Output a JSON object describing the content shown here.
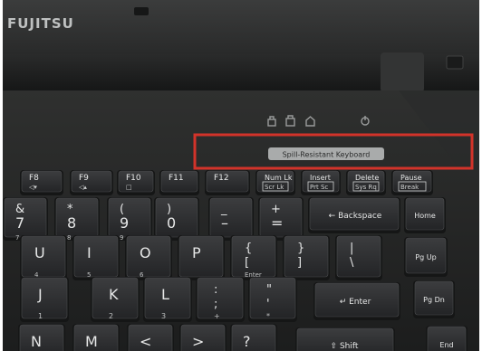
{
  "brand": {
    "logo_text": "FUJITSU"
  },
  "palmrest_label": "Spill-Resistant Keyboard",
  "highlight": {
    "stroke_color": "#d2332a"
  },
  "keys": {
    "row_fn": [
      {
        "id": "f8",
        "main": "F8",
        "sub": "◁▾"
      },
      {
        "id": "f9",
        "main": "F9",
        "sub": "◁▴"
      },
      {
        "id": "f10",
        "main": "F10",
        "sub": "□"
      },
      {
        "id": "f11",
        "main": "F11",
        "sub": ""
      },
      {
        "id": "f12",
        "main": "F12",
        "sub": ""
      },
      {
        "id": "numlk",
        "main": "Num Lk",
        "sub": "Scr Lk"
      },
      {
        "id": "insert",
        "main": "Insert",
        "sub": "Prt Sc"
      },
      {
        "id": "delete",
        "main": "Delete",
        "sub": "Sys Rq"
      },
      {
        "id": "pause",
        "main": "Pause",
        "sub": "Break"
      }
    ],
    "row_num": [
      {
        "id": "k7",
        "top": "&",
        "main": "7",
        "np": "7"
      },
      {
        "id": "k8",
        "top": "*",
        "main": "8",
        "np": "8"
      },
      {
        "id": "k9",
        "top": "(",
        "main": "9",
        "np": "9"
      },
      {
        "id": "k0",
        "top": ")",
        "main": "0",
        "np": ""
      },
      {
        "id": "minus",
        "top": "_",
        "main": "–",
        "np": ""
      },
      {
        "id": "equals",
        "top": "+",
        "main": "=",
        "np": ""
      }
    ],
    "backspace": "← Backspace",
    "home": "Home",
    "row_top": [
      {
        "id": "u",
        "main": "U",
        "np": "4"
      },
      {
        "id": "i",
        "main": "I",
        "np": "5"
      },
      {
        "id": "o",
        "main": "O",
        "np": "6"
      },
      {
        "id": "p",
        "main": "P",
        "np": ""
      },
      {
        "id": "lbrace",
        "top": "{",
        "main": "[",
        "np": "Enter"
      },
      {
        "id": "rbrace",
        "top": "}",
        "main": "]",
        "np": ""
      },
      {
        "id": "pipe",
        "top": "|",
        "main": "\\",
        "np": ""
      }
    ],
    "pgup": "Pg Up",
    "row_home": [
      {
        "id": "j",
        "main": "J",
        "np": "1"
      },
      {
        "id": "k",
        "main": "K",
        "np": "2"
      },
      {
        "id": "l",
        "main": "L",
        "np": "3"
      },
      {
        "id": "semicolon",
        "top": ":",
        "main": ";",
        "np": "+"
      },
      {
        "id": "quote",
        "top": "\"",
        "main": "'",
        "np": "*"
      }
    ],
    "enter": "↵ Enter",
    "pgdn": "Pg Dn",
    "row_bottom": [
      {
        "id": "n",
        "main": "N"
      },
      {
        "id": "m",
        "main": "M"
      },
      {
        "id": "comma",
        "main": "<"
      },
      {
        "id": "period",
        "main": ">"
      },
      {
        "id": "slash",
        "main": "?"
      }
    ],
    "shift": "⇧ Shift",
    "end": "End"
  }
}
